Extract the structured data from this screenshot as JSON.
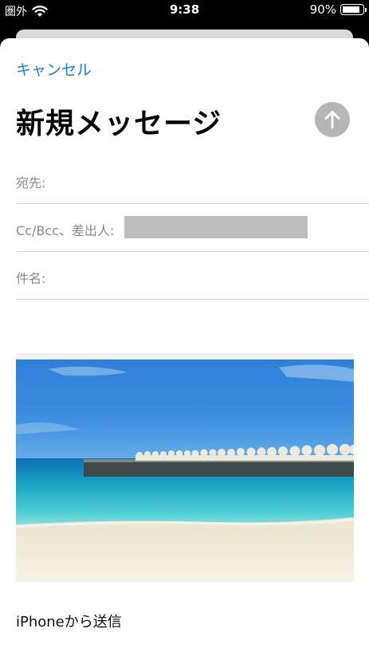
{
  "status_bar": {
    "carrier": "圏外",
    "time": "9:38",
    "battery": "90%",
    "battery_level": 0.9
  },
  "compose": {
    "cancel_label": "キャンセル",
    "title": "新規メッセージ",
    "fields": {
      "to_label": "宛先:",
      "cc_label": "Cc/Bcc、差出人:",
      "subject_label": "件名:"
    },
    "attachment_icon": "beach-photo",
    "signature": "iPhoneから送信",
    "accent_color": "#1a7fd6"
  }
}
